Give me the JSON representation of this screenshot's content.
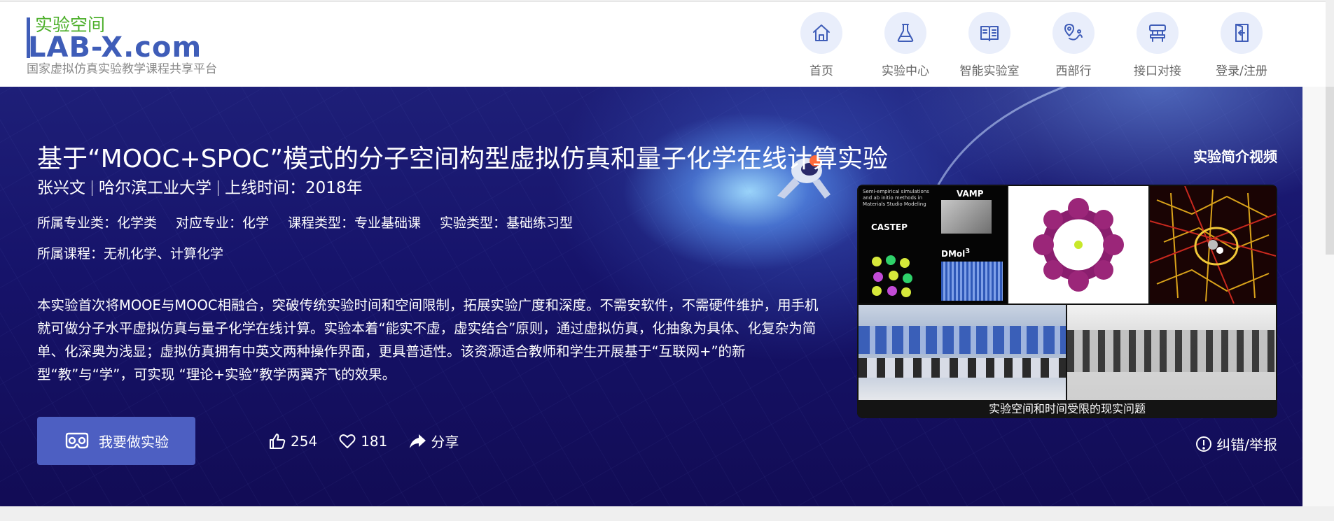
{
  "header": {
    "logo_cn": "实验空间",
    "logo_main": "LAB-X.com",
    "logo_sub": "国家虚拟仿真实验教学课程共享平台",
    "nav": [
      {
        "label": "首页",
        "icon": "home-icon"
      },
      {
        "label": "实验中心",
        "icon": "flask-icon"
      },
      {
        "label": "智能实验室",
        "icon": "book-icon"
      },
      {
        "label": "西部行",
        "icon": "route-icon"
      },
      {
        "label": "接口对接",
        "icon": "interface-icon"
      },
      {
        "label": "登录/注册",
        "icon": "login-door-icon"
      }
    ]
  },
  "experiment": {
    "title": "基于“MOOC+SPOC”模式的分子空间构型虚拟仿真和量子化学在线计算实验",
    "author": "张兴文",
    "university": "哈尔滨工业大学",
    "online_time": "上线时间：2018年",
    "info1": [
      "所属专业类：化学类",
      "对应专业：化学",
      "课程类型：专业基础课",
      "实验类型：基础练习型"
    ],
    "info2": "所属课程：无机化学、计算化学",
    "description": "本实验首次将MOOE与MOOC相融合，突破传统实验时间和空间限制，拓展实验广度和深度。不需安软件，不需硬件维护，用手机就可做分子水平虚拟仿真与量子化学在线计算。实验本着“能实不虚，虚实结合”原则，通过虚拟仿真，化抽象为具体、化复杂为简单、化深奥为浅显；虚拟仿真拥有中英文两种操作界面，更具普适性。该资源适合教师和学生开展基于“互联网+”的新型“教”与“学”，可实现 “理论+实验”教学两翼齐飞的效果。",
    "do_experiment_label": "我要做实验",
    "likes": "254",
    "favorites": "181",
    "share_label": "分享",
    "video_label": "实验简介视频",
    "report_label": "纠错/举报",
    "video_caption": "实验空间和时间受限的现实问题",
    "video_panel": {
      "intro_text": "Semi-empirical simulations and ab initio methods in Materials Studio Modeling",
      "vamp": "VAMP",
      "castep": "CASTEP",
      "dmol": "DMol",
      "dmol_sup": "3"
    }
  },
  "colors": {
    "brand_blue": "#3f5db8",
    "logo_green": "#4caf2a",
    "button_blue": "#4d5fc2",
    "banner_dark": "#16136a"
  }
}
